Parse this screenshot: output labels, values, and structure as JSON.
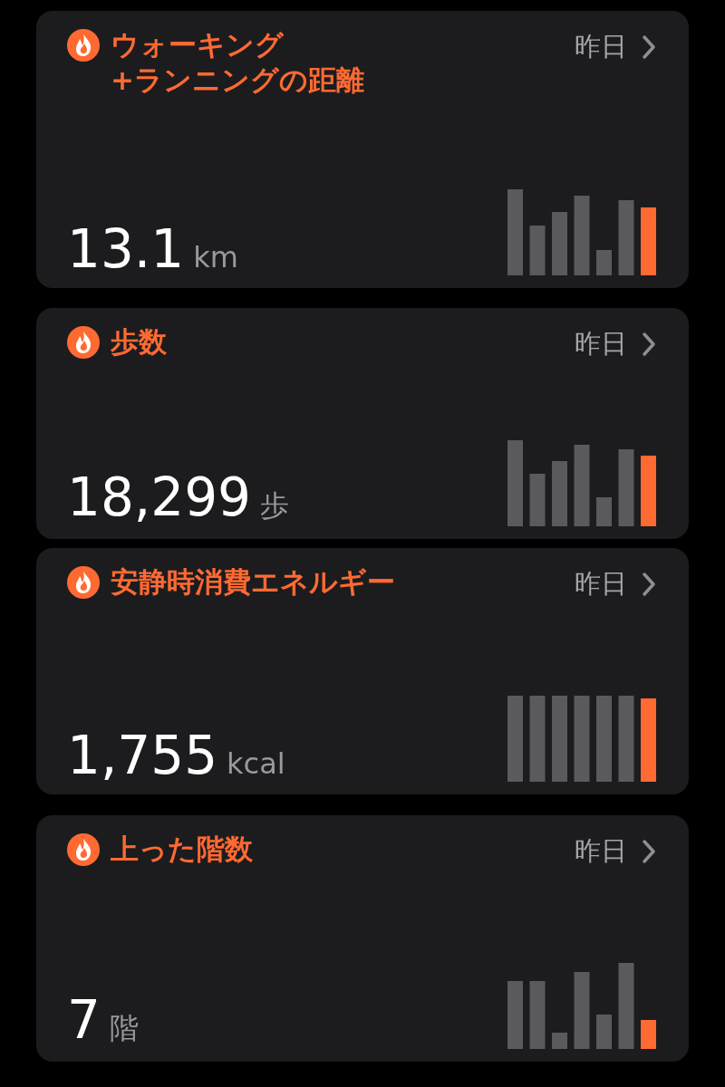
{
  "cards": [
    {
      "title": "ウォーキング\n+ランニングの距離",
      "date": "昨日",
      "value": "13.1",
      "unit": "km"
    },
    {
      "title": "歩数",
      "date": "昨日",
      "value": "18,299",
      "unit": "歩"
    },
    {
      "title": "安静時消費エネルギー",
      "date": "昨日",
      "value": "1,755",
      "unit": "kcal"
    },
    {
      "title": "上った階数",
      "date": "昨日",
      "value": "7",
      "unit": "階"
    }
  ]
}
